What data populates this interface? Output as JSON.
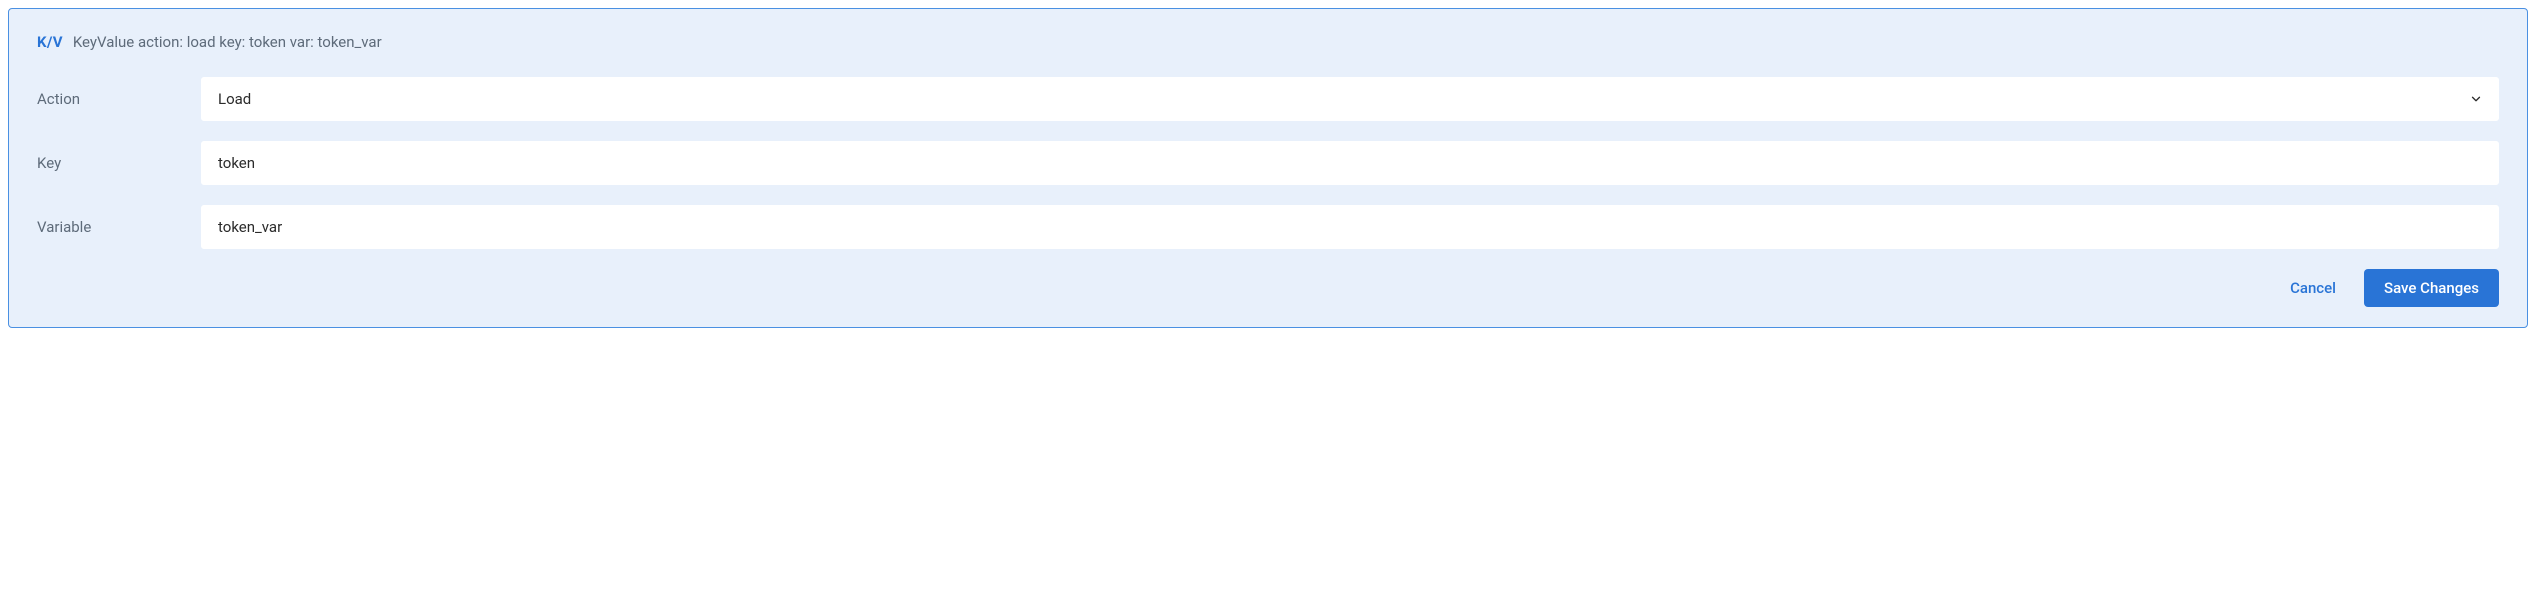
{
  "header": {
    "badge": "K/V",
    "title": "KeyValue action: load key: token var: token_var"
  },
  "form": {
    "action": {
      "label": "Action",
      "value": "Load"
    },
    "key": {
      "label": "Key",
      "value": "token"
    },
    "variable": {
      "label": "Variable",
      "value": "token_var"
    }
  },
  "footer": {
    "cancel_label": "Cancel",
    "save_label": "Save Changes"
  }
}
